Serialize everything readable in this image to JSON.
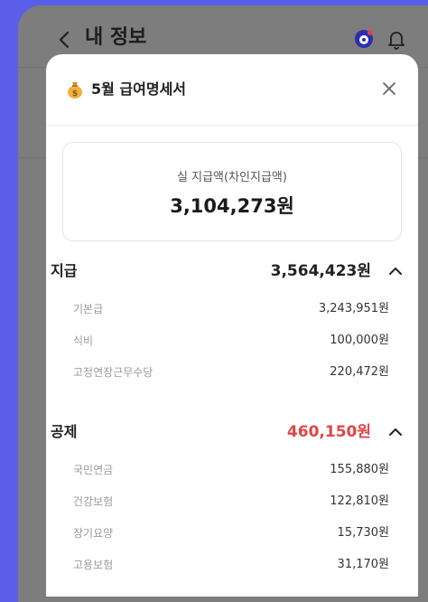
{
  "header": {
    "title": "내 정보",
    "back_icon": "chevron-left-icon",
    "bot_icon": "bot-icon",
    "bell_icon": "bell-icon"
  },
  "modal": {
    "title": "5월 급여명세서",
    "title_icon": "money-bag-icon",
    "close_icon": "close-icon",
    "net_pay": {
      "label": "실 지급액(차인지급액)",
      "value": "3,104,273원"
    },
    "payments": {
      "title": "지급",
      "total": "3,564,423원",
      "items": [
        {
          "label": "기본급",
          "value": "3,243,951원"
        },
        {
          "label": "식비",
          "value": "100,000원"
        },
        {
          "label": "고정연장근무수당",
          "value": "220,472원"
        }
      ]
    },
    "deductions": {
      "title": "공제",
      "total": "460,150원",
      "total_color": "#e04545",
      "items": [
        {
          "label": "국민연금",
          "value": "155,880원"
        },
        {
          "label": "건강보험",
          "value": "122,810원"
        },
        {
          "label": "장기요양",
          "value": "15,730원"
        },
        {
          "label": "고용보험",
          "value": "31,170원"
        }
      ]
    }
  },
  "colors": {
    "background": "#5b5ee8",
    "overlay": "#7d7d7d",
    "accent_red": "#e04545",
    "bot_blue": "#3b3fd9"
  }
}
